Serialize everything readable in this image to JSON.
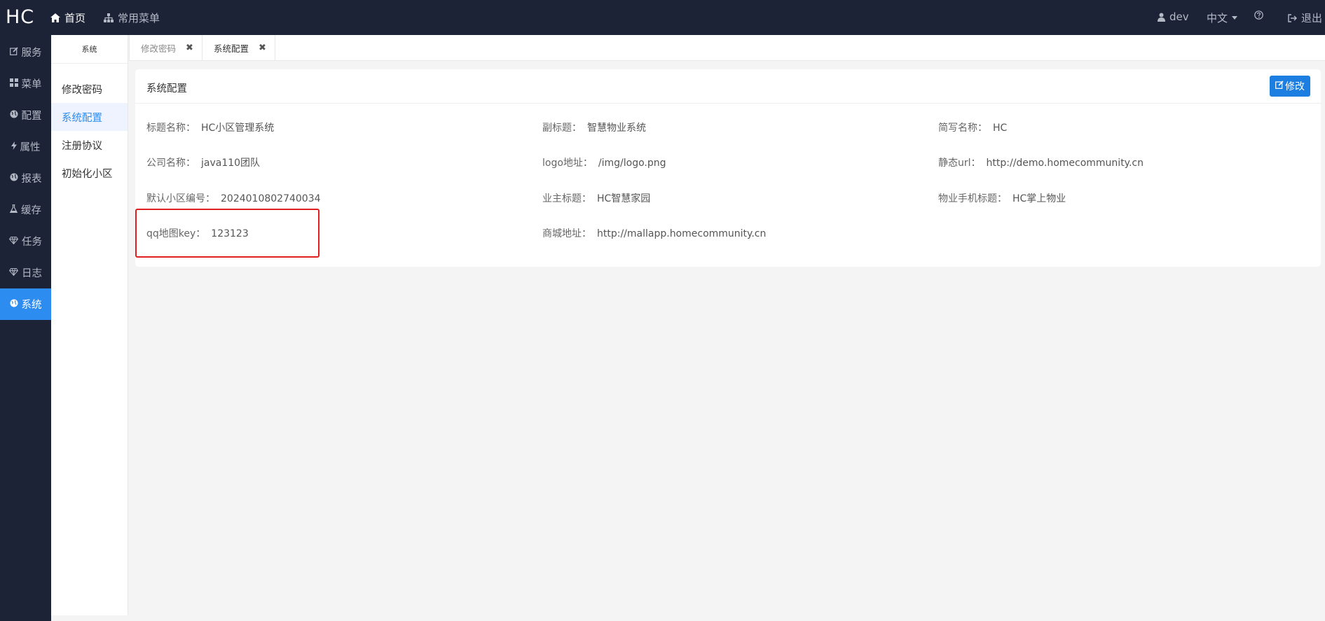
{
  "header": {
    "logo": "HC",
    "home": "首页",
    "common_menu": "常用菜单",
    "user": "dev",
    "lang": "中文",
    "logout": "退出"
  },
  "leftbar": {
    "items": [
      {
        "label": "服务",
        "icon": "edit-icon"
      },
      {
        "label": "菜单",
        "icon": "grid-icon"
      },
      {
        "label": "配置",
        "icon": "globe-icon"
      },
      {
        "label": "属性",
        "icon": "bolt-icon"
      },
      {
        "label": "报表",
        "icon": "globe-icon"
      },
      {
        "label": "缓存",
        "icon": "flask-icon"
      },
      {
        "label": "任务",
        "icon": "diamond-icon"
      },
      {
        "label": "日志",
        "icon": "diamond-icon"
      },
      {
        "label": "系统",
        "icon": "globe-icon",
        "active": true
      }
    ]
  },
  "submenu": {
    "title": "系统",
    "items": [
      "修改密码",
      "系统配置",
      "注册协议",
      "初始化小区"
    ],
    "active": "系统配置"
  },
  "tabs": [
    {
      "label": "修改密码"
    },
    {
      "label": "系统配置",
      "active": true
    }
  ],
  "card": {
    "title": "系统配置",
    "edit_label": "修改",
    "fields": [
      {
        "label": "标题名称：",
        "value": "HC小区管理系统"
      },
      {
        "label": "副标题：",
        "value": "智慧物业系统"
      },
      {
        "label": "简写名称：",
        "value": "HC"
      },
      {
        "label": "公司名称：",
        "value": "java110团队"
      },
      {
        "label": "logo地址：",
        "value": "/img/logo.png"
      },
      {
        "label": "静态url：",
        "value": "http://demo.homecommunity.cn"
      },
      {
        "label": "默认小区编号：",
        "value": "2024010802740034"
      },
      {
        "label": "业主标题：",
        "value": "HC智慧家园"
      },
      {
        "label": "物业手机标题：",
        "value": "HC掌上物业"
      },
      {
        "label": "qq地图key：",
        "value": "123123"
      },
      {
        "label": "商城地址：",
        "value": "http://mallapp.homecommunity.cn"
      }
    ]
  },
  "colors": {
    "nav_bg": "#1c2336",
    "accent": "#2d8cf0",
    "button": "#1b7ee0",
    "highlight": "#e02020"
  }
}
